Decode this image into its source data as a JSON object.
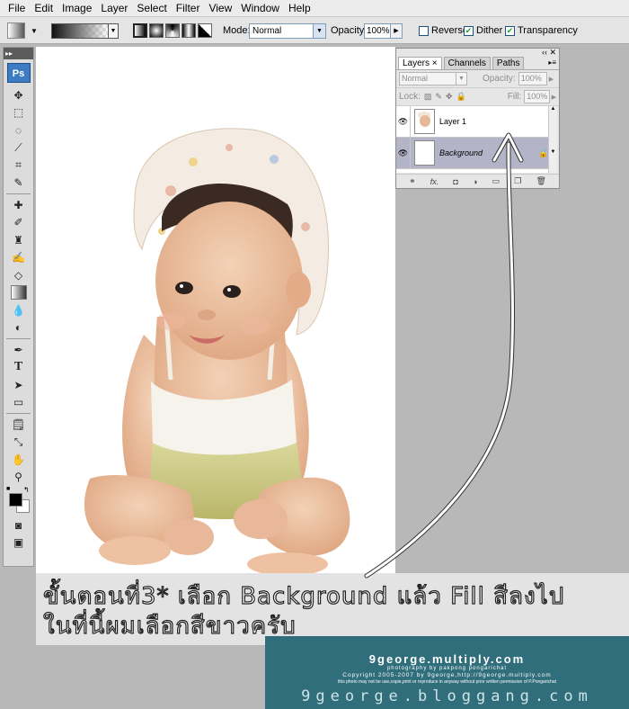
{
  "menubar": {
    "items": [
      "File",
      "Edit",
      "Image",
      "Layer",
      "Select",
      "Filter",
      "View",
      "Window",
      "Help"
    ]
  },
  "options": {
    "mode_label": "Mode:",
    "mode_value": "Normal",
    "opacity_label": "Opacity:",
    "opacity_value": "100%",
    "reverse_label": "Reverse",
    "reverse_checked": false,
    "dither_label": "Dither",
    "dither_checked": true,
    "transparency_label": "Transparency",
    "transparency_checked": true
  },
  "toolbox": {
    "logo": "Ps",
    "tools": [
      "move",
      "marquee",
      "lasso",
      "magic-wand",
      "crop",
      "slice",
      "healing",
      "brush",
      "stamp",
      "history-brush",
      "eraser",
      "gradient",
      "blur",
      "dodge",
      "pen",
      "type",
      "path-select",
      "shape",
      "notes",
      "eyedropper",
      "hand",
      "zoom"
    ],
    "foreground_color": "#000000",
    "background_color": "#ffffff"
  },
  "layers_panel": {
    "tabs": [
      "Layers",
      "Channels",
      "Paths"
    ],
    "blend_mode": "Normal",
    "opacity_label": "Opacity:",
    "opacity_value": "100%",
    "lock_label": "Lock:",
    "fill_label": "Fill:",
    "fill_value": "100%",
    "layers": [
      {
        "name": "Layer 1",
        "active": false,
        "locked": false
      },
      {
        "name": "Background",
        "active": true,
        "locked": true
      }
    ]
  },
  "caption": {
    "line1": "ขั้นตอนที่3* เลือก Background แล้ว Fill สีลงไป",
    "line2": "ในที่นี้ผมเลือกสีขาวครับ"
  },
  "watermark": {
    "site": "9george.multiply.com",
    "photo_credit": "photography by pakpong pongarichat",
    "copyright": "Copyright 2005-2007 by 9george,http://9george.multiply.com",
    "note": "this photo may not be use,copie,print or reproduce in anyway without prior written permission of P.Pongarichat",
    "blog": "9george.bloggang.com"
  }
}
